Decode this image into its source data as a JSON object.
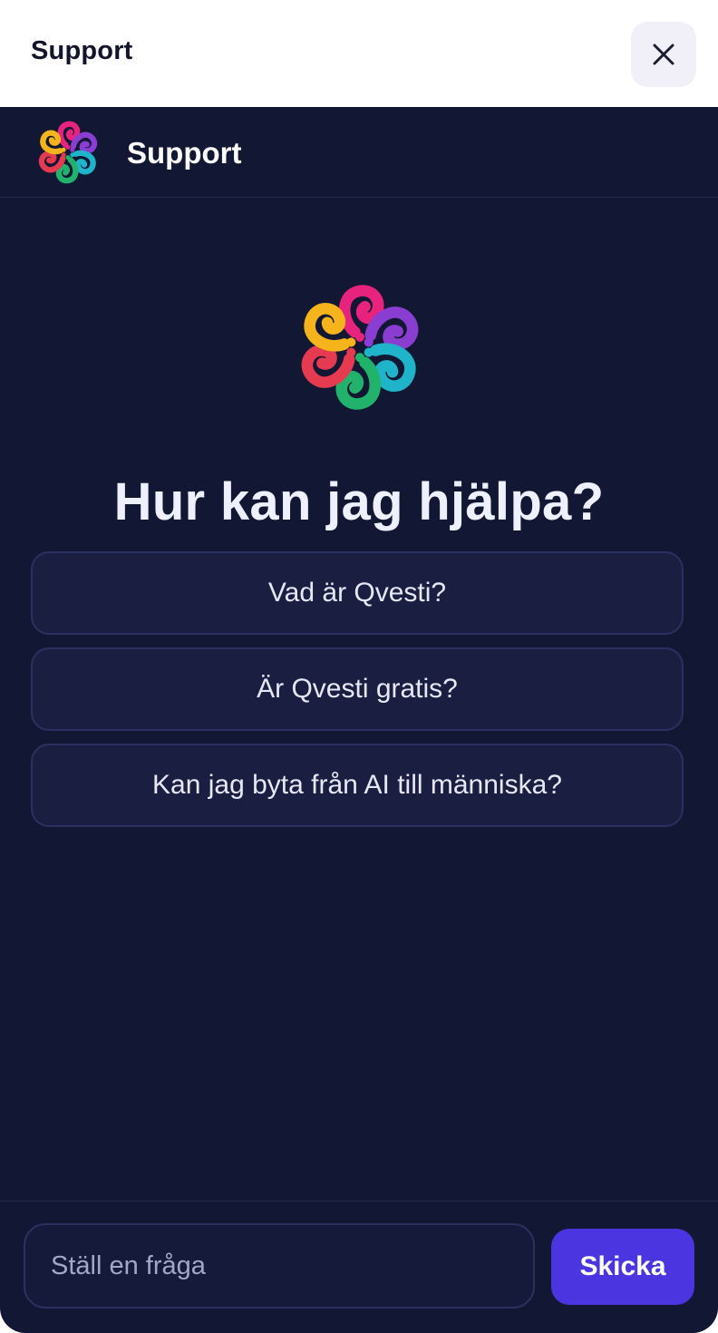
{
  "topbar": {
    "title": "Support",
    "close_icon": "close-icon"
  },
  "chat": {
    "header_title": "Support",
    "logo_icon": "question-flower-logo",
    "heading": "Hur kan jag hjälpa?",
    "suggestions": [
      {
        "label": "Vad är Qvesti?"
      },
      {
        "label": "Är Qvesti gratis?"
      },
      {
        "label": "Kan jag byta från AI till människa?"
      }
    ]
  },
  "composer": {
    "placeholder": "Ställ en fråga",
    "value": "",
    "send_label": "Skicka"
  },
  "colors": {
    "panel_bg": "#121833",
    "accent": "#4b35e0",
    "suggestion_bg": "#1a1f42",
    "logo_petals": [
      "#e8237d",
      "#8a3dd1",
      "#1fb4c9",
      "#21b36b",
      "#e53a4f",
      "#f5b41c"
    ]
  }
}
